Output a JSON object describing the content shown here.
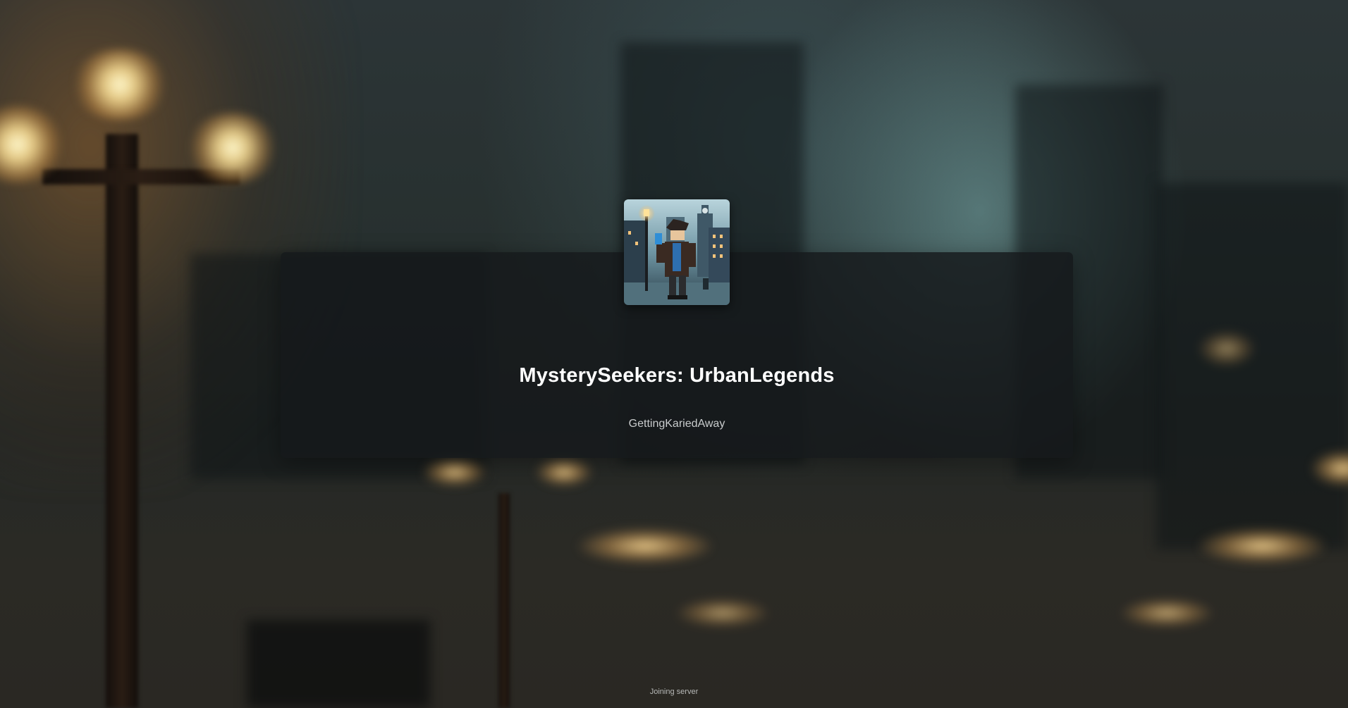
{
  "game": {
    "title": "MysterySeekers: UrbanLegends",
    "creator": "GettingKariedAway",
    "icon": "game-thumbnail-detective-character"
  },
  "loading": {
    "status_text": "Joining server"
  },
  "colors": {
    "card_background": "#16191b",
    "title_text": "#ffffff",
    "creator_text": "#c9cccd",
    "status_text": "#b7b9b8"
  }
}
